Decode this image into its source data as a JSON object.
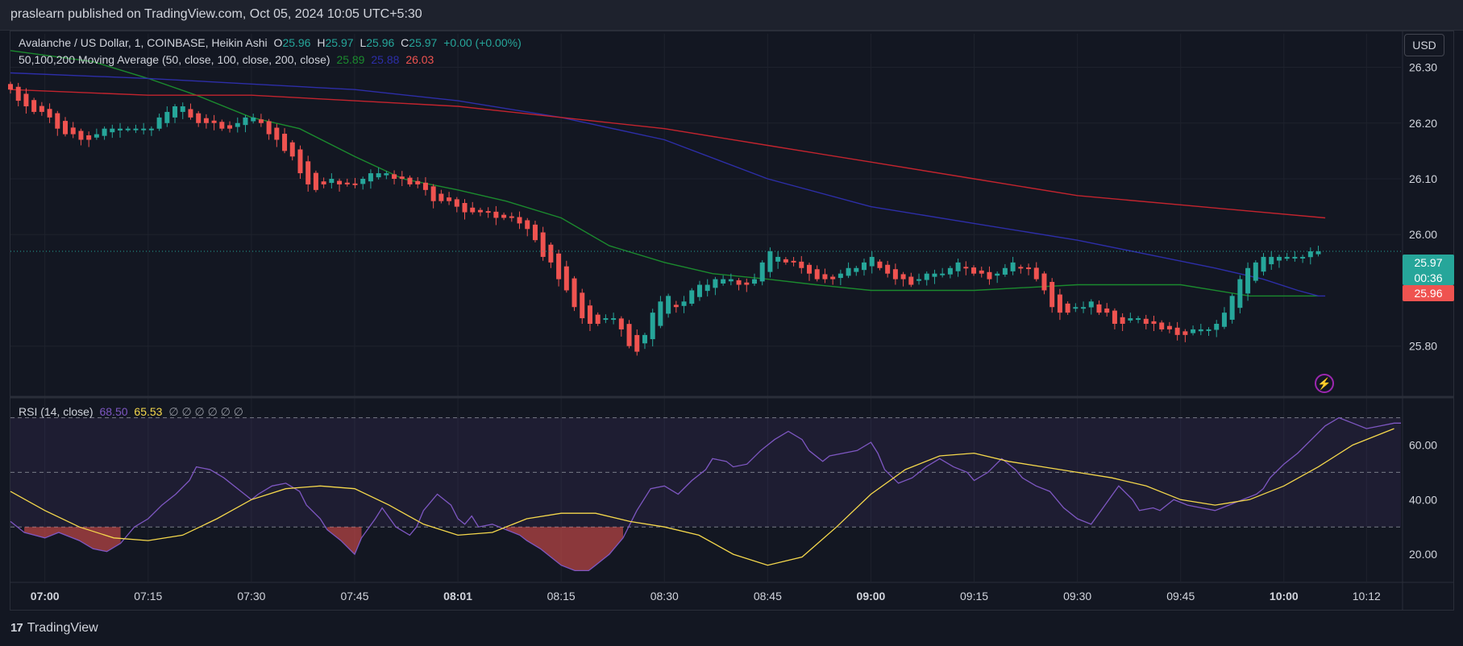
{
  "header": {
    "publisher_text": "praslearn published on TradingView.com, Oct 05, 2024 10:05 UTC+5:30"
  },
  "legend": {
    "symbol": "Avalanche / US Dollar, 1, COINBASE, Heikin Ashi",
    "o_label": "O",
    "o_value": "25.96",
    "h_label": "H",
    "h_value": "25.97",
    "l_label": "L",
    "l_value": "25.96",
    "c_label": "C",
    "c_value": "25.97",
    "change": "+0.00 (+0.00%)",
    "ma_label": "50,100,200 Moving Average (50, close, 100, close, 200, close)",
    "ma50_value": "25.89",
    "ma100_value": "25.88",
    "ma200_value": "26.03",
    "rsi_label": "RSI (14, close)",
    "rsi_value": "68.50",
    "rsi_ma_value": "65.53",
    "rsi_empty": "∅ ∅ ∅ ∅ ∅ ∅"
  },
  "currency_button": "USD",
  "price_tags": {
    "current": "25.97",
    "countdown": "00:36",
    "open": "25.96"
  },
  "brand": {
    "logo": "17",
    "name": "TradingView"
  },
  "colors": {
    "background": "#131722",
    "up": "#26a69a",
    "down": "#ef5350",
    "ma50": "#1b8a2e",
    "ma100": "#2d2ea8",
    "ma200": "#c2242e",
    "rsi": "#7e57c2",
    "rsi_ma": "#f5d84c"
  },
  "icons": {
    "alert": "lightning-bolt-icon"
  },
  "chart_data": [
    {
      "type": "candlestick",
      "style": "Heikin Ashi",
      "title": "Avalanche / US Dollar, 1, COINBASE, Heikin Ashi",
      "y_ticks": [
        "25.80",
        "26.00",
        "26.10",
        "26.20",
        "26.30"
      ],
      "ylim": [
        25.71,
        26.36
      ],
      "x_ticks": [
        "07:00",
        "07:15",
        "07:30",
        "07:45",
        "08:01",
        "08:15",
        "08:30",
        "08:45",
        "09:00",
        "09:15",
        "09:30",
        "09:45",
        "10:00",
        "10:12"
      ],
      "x_ticks_bold": [
        "07:00",
        "08:01",
        "09:00",
        "10:00"
      ],
      "x_range_minutes": [
        -5,
        197
      ],
      "closes": [
        26.26,
        26.24,
        26.23,
        26.22,
        26.22,
        26.21,
        26.19,
        26.18,
        26.18,
        26.17,
        26.17,
        26.18,
        26.19,
        26.19,
        26.19,
        26.19,
        26.19,
        26.19,
        26.19,
        26.21,
        26.22,
        26.23,
        26.23,
        26.21,
        26.2,
        26.2,
        26.2,
        26.19,
        26.19,
        26.2,
        26.21,
        26.21,
        26.2,
        26.18,
        26.17,
        26.15,
        26.14,
        26.11,
        26.09,
        26.08,
        26.09,
        26.1,
        26.09,
        26.09,
        26.09,
        26.1,
        26.11,
        26.11,
        26.11,
        26.1,
        26.1,
        26.09,
        26.09,
        26.08,
        26.06,
        26.06,
        26.06,
        26.05,
        26.04,
        26.04,
        26.04,
        26.04,
        26.03,
        26.03,
        26.03,
        26.02,
        26.01,
        25.99,
        25.96,
        25.95,
        25.92,
        25.9,
        25.87,
        25.85,
        25.84,
        25.84,
        25.85,
        25.85,
        25.83,
        25.8,
        25.79,
        25.82,
        25.86,
        25.88,
        25.89,
        25.87,
        25.88,
        25.9,
        25.91,
        25.91,
        25.92,
        25.92,
        25.92,
        25.91,
        25.91,
        25.92,
        25.95,
        25.97,
        25.96,
        25.95,
        25.95,
        25.94,
        25.93,
        25.92,
        25.92,
        25.92,
        25.93,
        25.94,
        25.94,
        25.95,
        25.96,
        25.94,
        25.93,
        25.92,
        25.92,
        25.91,
        25.92,
        25.93,
        25.93,
        25.93,
        25.94,
        25.95,
        25.94,
        25.93,
        25.93,
        25.92,
        25.93,
        25.94,
        25.95,
        25.94,
        25.94,
        25.92,
        25.9,
        25.87,
        25.86,
        25.86,
        25.87,
        25.87,
        25.88,
        25.86,
        25.86,
        25.84,
        25.84,
        25.85,
        25.85,
        25.84,
        25.84,
        25.83,
        25.83,
        25.82,
        25.82,
        25.83,
        25.83,
        25.83,
        25.84,
        25.86,
        25.89,
        25.92,
        25.94,
        25.95,
        25.96,
        25.96,
        25.96,
        25.96,
        25.96,
        25.96,
        25.97,
        25.97
      ],
      "series": [
        {
          "name": "MA 50",
          "values": [
            26.33,
            26.31,
            26.28,
            26.25,
            26.21,
            26.19,
            26.14,
            26.1,
            26.08,
            26.06,
            26.03,
            25.98,
            25.95,
            25.93,
            25.92,
            25.91,
            25.9,
            25.9,
            25.9,
            25.91,
            25.91,
            25.89,
            25.89
          ],
          "x_minutes": [
            -5,
            7,
            15,
            22,
            30,
            37,
            45,
            52,
            60,
            67,
            75,
            82,
            90,
            97,
            105,
            112,
            120,
            127,
            135,
            150,
            165,
            175,
            185
          ]
        },
        {
          "name": "MA 100",
          "values": [
            26.29,
            26.28,
            26.27,
            26.26,
            26.24,
            26.21,
            26.17,
            26.1,
            26.05,
            26.02,
            25.99,
            25.96,
            25.94,
            25.92,
            25.9,
            25.89,
            25.89
          ],
          "x_minutes": [
            -5,
            15,
            30,
            45,
            60,
            75,
            90,
            105,
            120,
            135,
            150,
            162,
            170,
            177,
            182,
            185,
            186
          ]
        },
        {
          "name": "MA 200",
          "values": [
            26.26,
            26.25,
            26.25,
            26.24,
            26.23,
            26.21,
            26.19,
            26.16,
            26.13,
            26.1,
            26.07,
            26.03
          ],
          "x_minutes": [
            -5,
            15,
            30,
            45,
            60,
            75,
            90,
            105,
            120,
            135,
            150,
            186
          ]
        }
      ]
    },
    {
      "type": "line",
      "title": "RSI (14, close)",
      "y_ticks": [
        "20.00",
        "40.00",
        "60.00"
      ],
      "ylim": [
        10,
        74
      ],
      "bands": [
        30,
        50,
        70
      ],
      "series": [
        {
          "name": "RSI",
          "values": [
            32,
            28,
            26,
            28,
            25,
            22,
            21,
            24,
            30,
            33,
            38,
            42,
            47,
            52,
            51,
            48,
            44,
            40,
            42,
            45,
            46,
            43,
            38,
            33,
            29,
            25,
            20,
            26,
            33,
            37,
            30,
            27,
            30,
            36,
            42,
            38,
            33,
            31,
            34,
            30,
            31,
            30,
            29,
            27,
            25,
            22,
            18,
            16,
            14,
            14,
            16,
            18,
            20,
            26,
            36,
            44,
            45,
            42,
            47,
            51,
            55,
            54,
            52,
            53,
            58,
            62,
            65,
            62,
            58,
            54,
            56,
            57,
            58,
            61,
            57,
            51,
            46,
            48,
            52,
            55,
            52,
            50,
            47,
            50,
            55,
            51,
            48,
            45,
            43,
            37,
            33,
            31,
            38,
            45,
            40,
            36,
            37,
            36,
            40,
            38,
            37,
            36,
            38,
            40,
            42,
            44,
            48,
            53,
            57,
            62,
            67,
            70,
            68,
            66,
            67,
            68,
            68
          ],
          "x_minutes": [
            -5,
            -3,
            0,
            2,
            5,
            7,
            9,
            11,
            13,
            15,
            17,
            19,
            21,
            22,
            24,
            26,
            28,
            30,
            31,
            33,
            35,
            37,
            38,
            40,
            41,
            43,
            45,
            46,
            48,
            49,
            51,
            53,
            54,
            55,
            57,
            59,
            60,
            61,
            62,
            63,
            65,
            66,
            67,
            69,
            70,
            72,
            74,
            75,
            77,
            79,
            80,
            81,
            82,
            84,
            86,
            88,
            90,
            92,
            94,
            96,
            97,
            99,
            100,
            102,
            104,
            106,
            108,
            110,
            111,
            113,
            114,
            116,
            118,
            120,
            121,
            122,
            124,
            126,
            128,
            130,
            132,
            134,
            135,
            137,
            139,
            141,
            142,
            144,
            146,
            148,
            150,
            152,
            154,
            156,
            158,
            159,
            161,
            162,
            164,
            166,
            168,
            170,
            172,
            174,
            176,
            177,
            178,
            180,
            182,
            184,
            186,
            188,
            190,
            192,
            194,
            196,
            197
          ]
        },
        {
          "name": "RSI MA",
          "values": [
            43,
            36,
            30,
            26,
            25,
            27,
            33,
            40,
            44,
            45,
            44,
            38,
            31,
            27,
            28,
            33,
            35,
            35,
            32,
            30,
            27,
            20,
            16,
            19,
            30,
            42,
            51,
            56,
            57,
            54,
            52,
            50,
            48,
            45,
            40,
            38,
            40,
            45,
            52,
            60,
            66
          ],
          "x_minutes": [
            -5,
            0,
            5,
            10,
            15,
            20,
            25,
            30,
            35,
            40,
            45,
            50,
            55,
            60,
            65,
            70,
            75,
            80,
            85,
            90,
            95,
            100,
            105,
            110,
            115,
            120,
            125,
            130,
            135,
            140,
            145,
            150,
            155,
            160,
            165,
            170,
            175,
            180,
            185,
            190,
            196
          ]
        }
      ]
    }
  ]
}
